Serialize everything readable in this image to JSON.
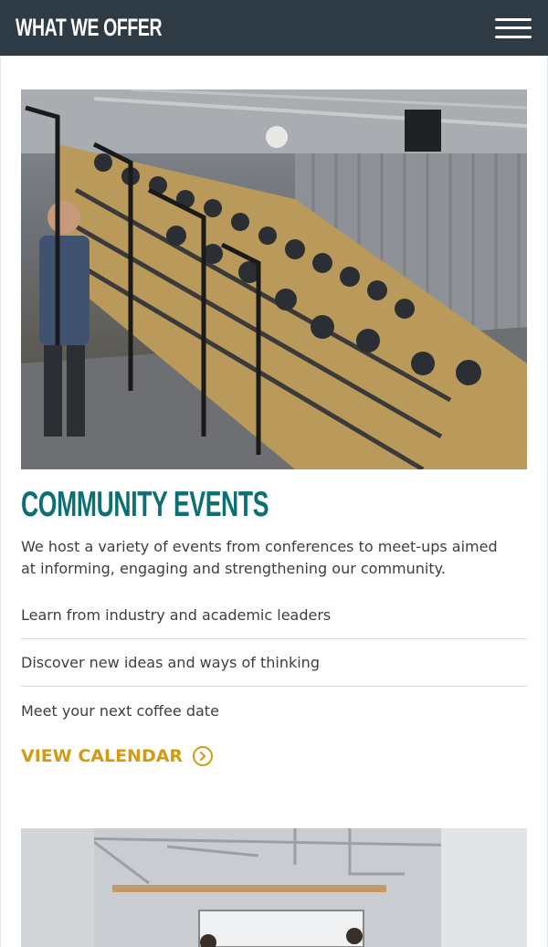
{
  "header": {
    "title": "WHAT WE OFFER",
    "menu_icon": "hamburger-menu-icon"
  },
  "events": {
    "image_alt": "Audience seated on stadium stairs at a conference",
    "title": "COMMUNITY EVENTS",
    "intro": "We host a variety of events from conferences to meet-ups aimed at informing, engaging and strengthening our community.",
    "bullets": [
      "Learn from industry and academic leaders",
      "Discover new ideas and ways of thinking",
      "Meet your next coffee date"
    ],
    "cta_label": "VIEW CALENDAR",
    "cta_icon": "chevron-right-circle-icon"
  },
  "next_section": {
    "image_alt": "Bright office interior with whiteboard"
  },
  "colors": {
    "header_bg": "#2e3b45",
    "title_teal": "#0e6f73",
    "accent_gold": "#d39b12",
    "body_text": "#3b3f44"
  }
}
